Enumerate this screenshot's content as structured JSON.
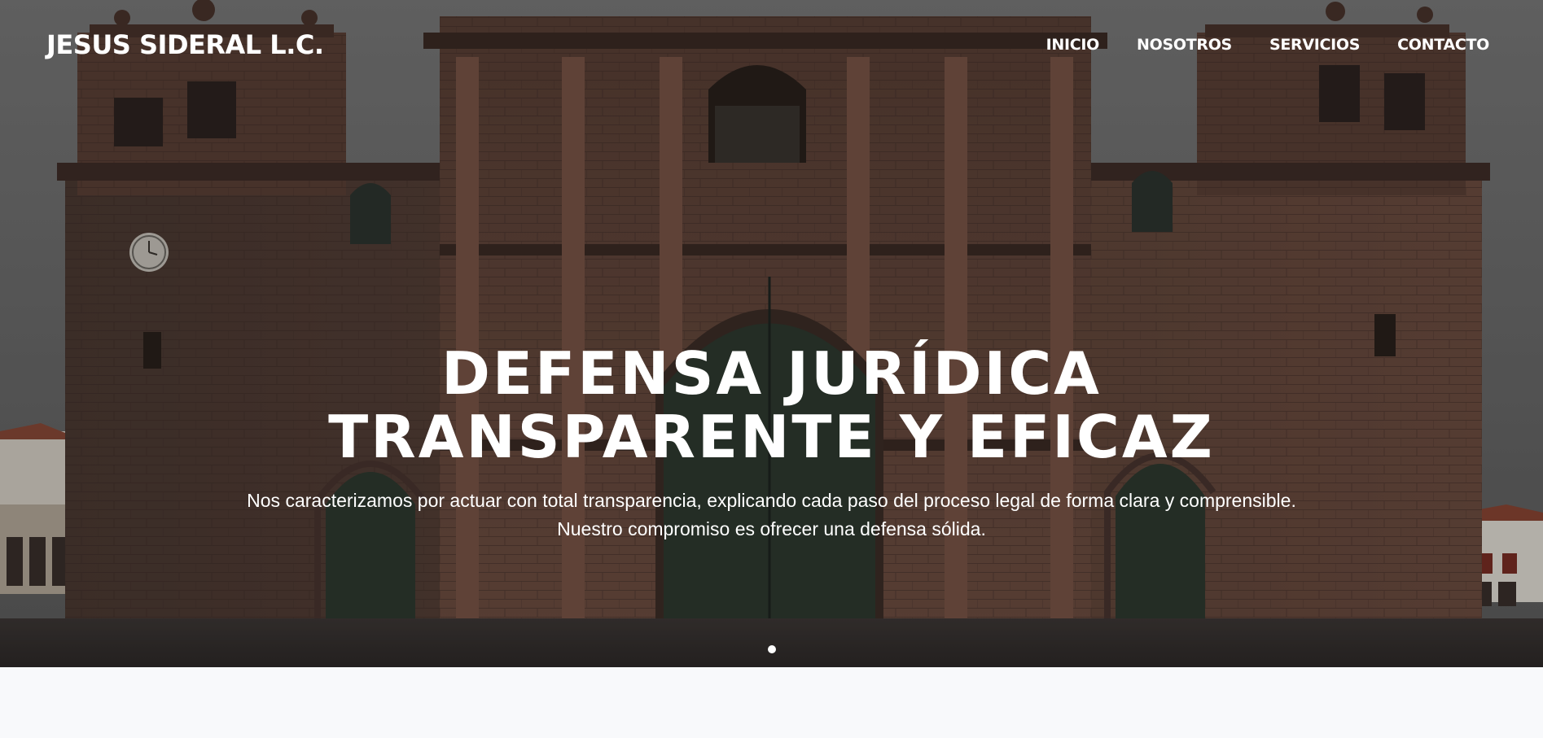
{
  "navbar": {
    "brand": "JESUS SIDERAL L.C.",
    "links": [
      "INICIO",
      "NOSOTROS",
      "SERVICIOS",
      "CONTACTO"
    ]
  },
  "hero": {
    "title": "DEFENSA JURÍDICA TRANSPARENTE Y EFICAZ",
    "subtitle_line1": "Nos caracterizamos por actuar con total transparencia, explicando cada paso del proceso legal de forma clara y comprensible.",
    "subtitle_line2": "Nuestro compromiso es ofrecer una defensa sólida.",
    "background_image": "cathedral-facade-photo"
  },
  "carousel": {
    "slide_count": 1,
    "active_index": 0
  },
  "colors": {
    "text_on_hero": "#ffffff",
    "page_background": "#f8f9fb",
    "stone": "#6b4a3d",
    "sky": "#6a6a6a",
    "door": "#2f3a30"
  }
}
